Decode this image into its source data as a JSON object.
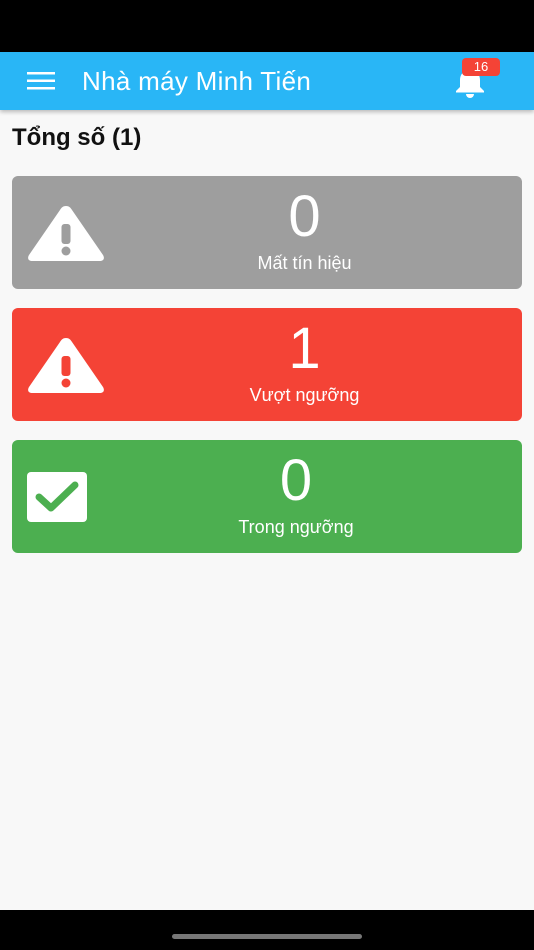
{
  "app_bar": {
    "title": "Nhà máy Minh Tiến",
    "notification_count": "16",
    "background": "#29b6f6"
  },
  "summary": {
    "title": "Tổng số (1)"
  },
  "cards": [
    {
      "count": "0",
      "label": "Mất tín hiệu",
      "icon": "warning-icon",
      "color": "#9e9e9e"
    },
    {
      "count": "1",
      "label": "Vượt ngưỡng",
      "icon": "warning-icon",
      "color": "#f44336"
    },
    {
      "count": "0",
      "label": "Trong ngưỡng",
      "icon": "checkbox-check-icon",
      "color": "#4caf50"
    }
  ]
}
